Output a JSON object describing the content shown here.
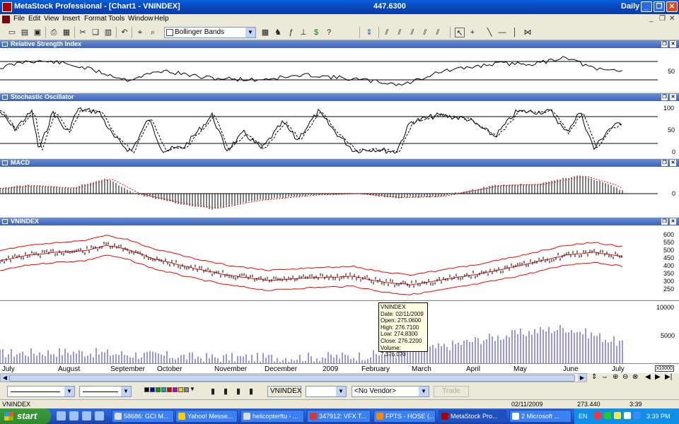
{
  "window": {
    "title": "MetaStock Professional - [Chart1 - VNINDEX]",
    "price": "447.6300",
    "period": "Daily"
  },
  "menu": [
    "File",
    "Edit",
    "View",
    "Insert",
    "Format",
    "Tools",
    "Window",
    "Help"
  ],
  "toolbar": {
    "indicator": "Bollinger Bands"
  },
  "panes": {
    "rsi": {
      "title": "Relative Strength Index",
      "ticks": [
        "50"
      ]
    },
    "stoch": {
      "title": "Stochastic Oscillator",
      "ticks": [
        "100",
        "50",
        "0"
      ]
    },
    "macd": {
      "title": "MACD",
      "ticks": [
        "0"
      ]
    },
    "price": {
      "title": "VNINDEX",
      "ticks": [
        "600",
        "550",
        "500",
        "450",
        "400",
        "350",
        "300",
        "250"
      ]
    },
    "volume": {
      "ticks": [
        "10000",
        "5000"
      ],
      "scale_note": "x10000"
    }
  },
  "tooltip": {
    "lines": [
      "VNINDEX",
      "Date: 02/11/2009",
      "Open: 275.0600",
      "High: 276.7100",
      "Low: 274.8300",
      "Close: 276.2200",
      "Volume: 7,376,070"
    ]
  },
  "months": [
    "July",
    "August",
    "September",
    "October",
    "November",
    "December",
    "2009",
    "February",
    "March",
    "April",
    "May",
    "June",
    "July"
  ],
  "stylebar": {
    "security": "VNINDEX",
    "vendor": "<No Vendor>",
    "trade": "Trade"
  },
  "status": {
    "security": "VNINDEX",
    "date": "02/11/2009",
    "value": "273.440",
    "time": "3:39"
  },
  "taskbar": {
    "start": "start",
    "tasks": [
      "58686: GCI M...",
      "Yahoo! Messe...",
      "helicopterftu - ...",
      "347912: VFX T...",
      "FPTS - HOSE (...",
      "MetaStock Pro...",
      "2 Microsoft ..."
    ],
    "lang": "EN",
    "clock": "3:39 PM"
  },
  "colors": {
    "bands": "#ff0000",
    "volume_bar": "#3030c0",
    "macd_signal": "#ff0000",
    "title_bar": "#0a5fd8"
  }
}
